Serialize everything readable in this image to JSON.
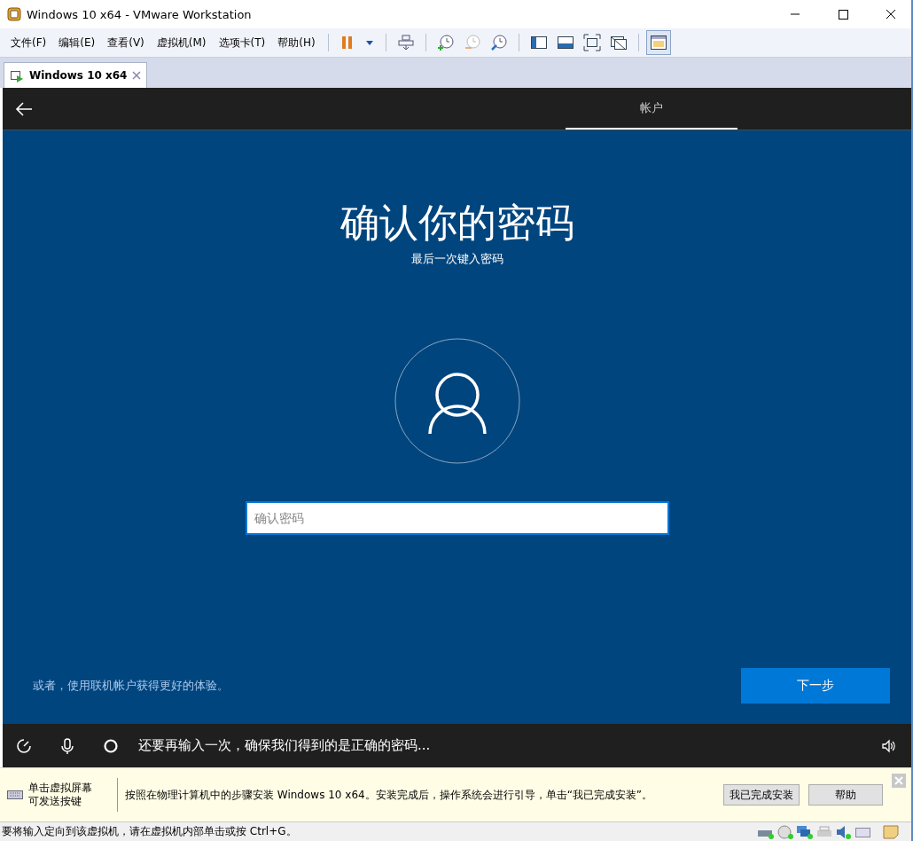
{
  "window": {
    "title": "Windows 10 x64 - VMware Workstation"
  },
  "menu": [
    "文件(F)",
    "编辑(E)",
    "查看(V)",
    "虚拟机(M)",
    "选项卡(T)",
    "帮助(H)"
  ],
  "tabs": [
    {
      "label": "Windows 10 x64",
      "selected": true
    }
  ],
  "vm": {
    "header_tabs": [
      {
        "label": "帐户",
        "selected": true
      }
    ],
    "title": "确认你的密码",
    "subtitle": "最后一次键入密码",
    "password": {
      "placeholder": "确认密码"
    },
    "link": "或者，使用联机帐户获得更好的体验。",
    "next_button": "下一步",
    "caption": "还要再输入一次，确保我们得到的是正确的密码..."
  },
  "notification": {
    "hint": [
      "单击虚拟屏幕",
      "可发送按键"
    ],
    "message": "按照在物理计算机中的步骤安装 Windows 10 x64。安装完成后，操作系统会进行引导，单击“我已完成安装”。",
    "buttons": [
      "我已完成安装",
      "帮助"
    ]
  },
  "status_bar": "要将输入定向到该虚拟机，请在虚拟机内部单击或按 Ctrl+G。"
}
